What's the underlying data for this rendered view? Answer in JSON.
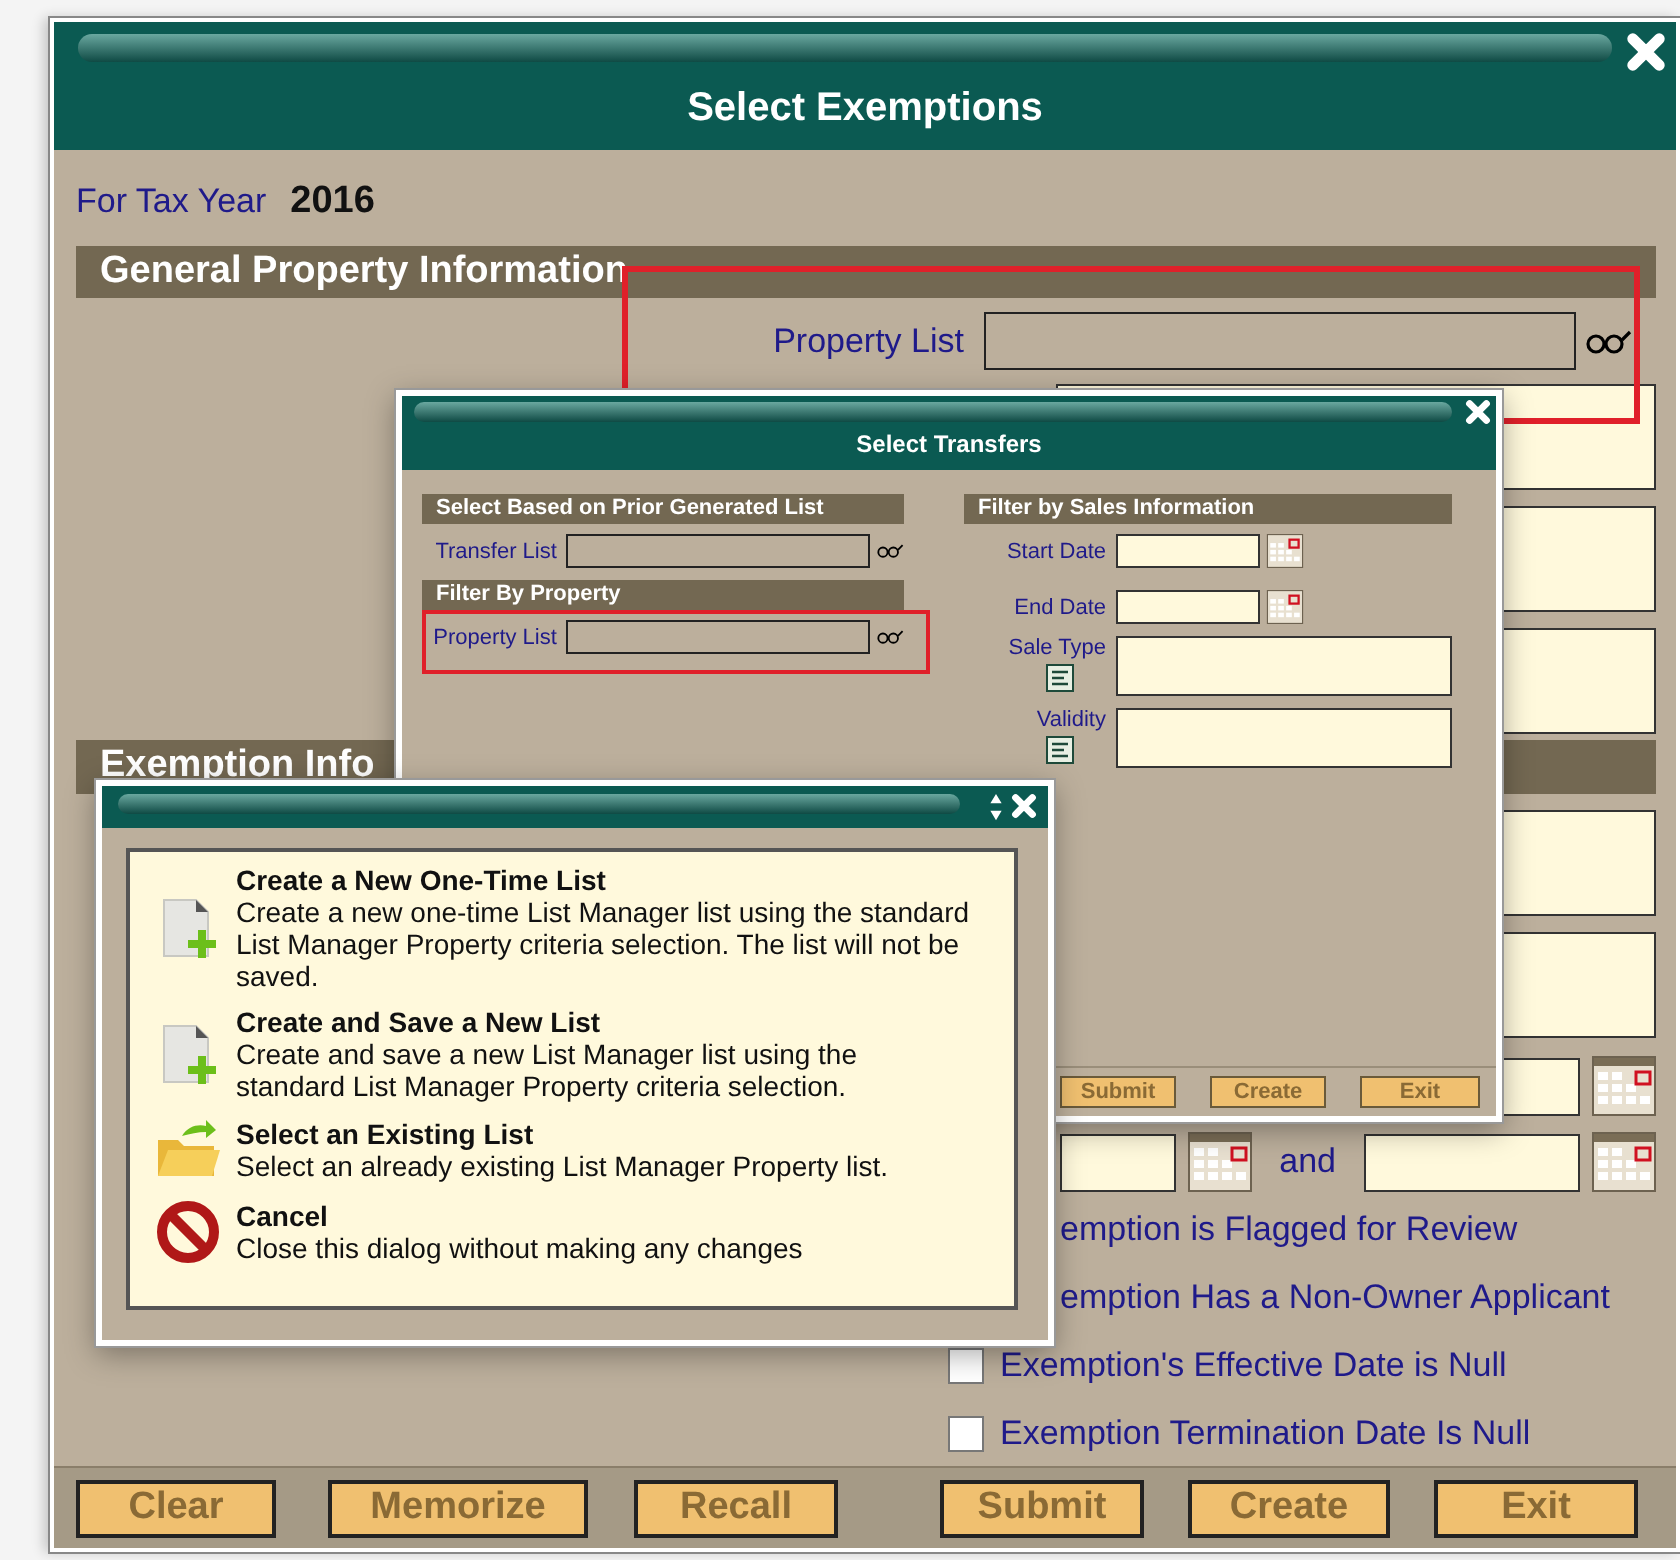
{
  "main_window": {
    "title": "Select Exemptions",
    "tax_year_label": "For Tax Year",
    "tax_year": "2016",
    "general_header": "General Property Information",
    "property_list_label": "Property List",
    "exemption_header": "Exemption Info",
    "and_label": "and",
    "checkboxes": [
      {
        "kind": "label_only",
        "label": "emption is Flagged for Review"
      },
      {
        "kind": "label_only",
        "label": "emption Has a Non-Owner Applicant"
      },
      {
        "kind": "checkbox",
        "label": "Exemption's Effective Date is Null",
        "checked": false
      },
      {
        "kind": "checkbox",
        "label": "Exemption Termination Date Is Null",
        "checked": false
      }
    ],
    "buttons": [
      "Clear",
      "Memorize",
      "Recall",
      "Submit",
      "Create",
      "Exit"
    ]
  },
  "transfers_dialog": {
    "title": "Select Transfers",
    "prior_header": "Select Based on Prior Generated List",
    "transfer_list_label": "Transfer List",
    "property_header": "Filter By Property",
    "property_list_label": "Property List",
    "sales_header": "Filter by Sales Information",
    "start_date_label": "Start Date",
    "end_date_label": "End Date",
    "sale_type_label": "Sale Type",
    "validity_label": "Validity",
    "buttons": [
      "Submit",
      "Create",
      "Exit"
    ]
  },
  "list_dialog": {
    "options": [
      {
        "kind": "new",
        "title": "Create a New One-Time List",
        "description": "Create a new one-time List Manager list using the standard List Manager Property criteria selection. The list will not be saved."
      },
      {
        "kind": "new",
        "title": "Create and Save a New List",
        "description": "Create and save a new List Manager list using the standard List Manager Property criteria selection."
      },
      {
        "kind": "open",
        "title": "Select an Existing List",
        "description": "Select an already existing List Manager Property list."
      },
      {
        "kind": "cancel",
        "title": "Cancel",
        "description": "Close this dialog without making any changes"
      }
    ]
  }
}
